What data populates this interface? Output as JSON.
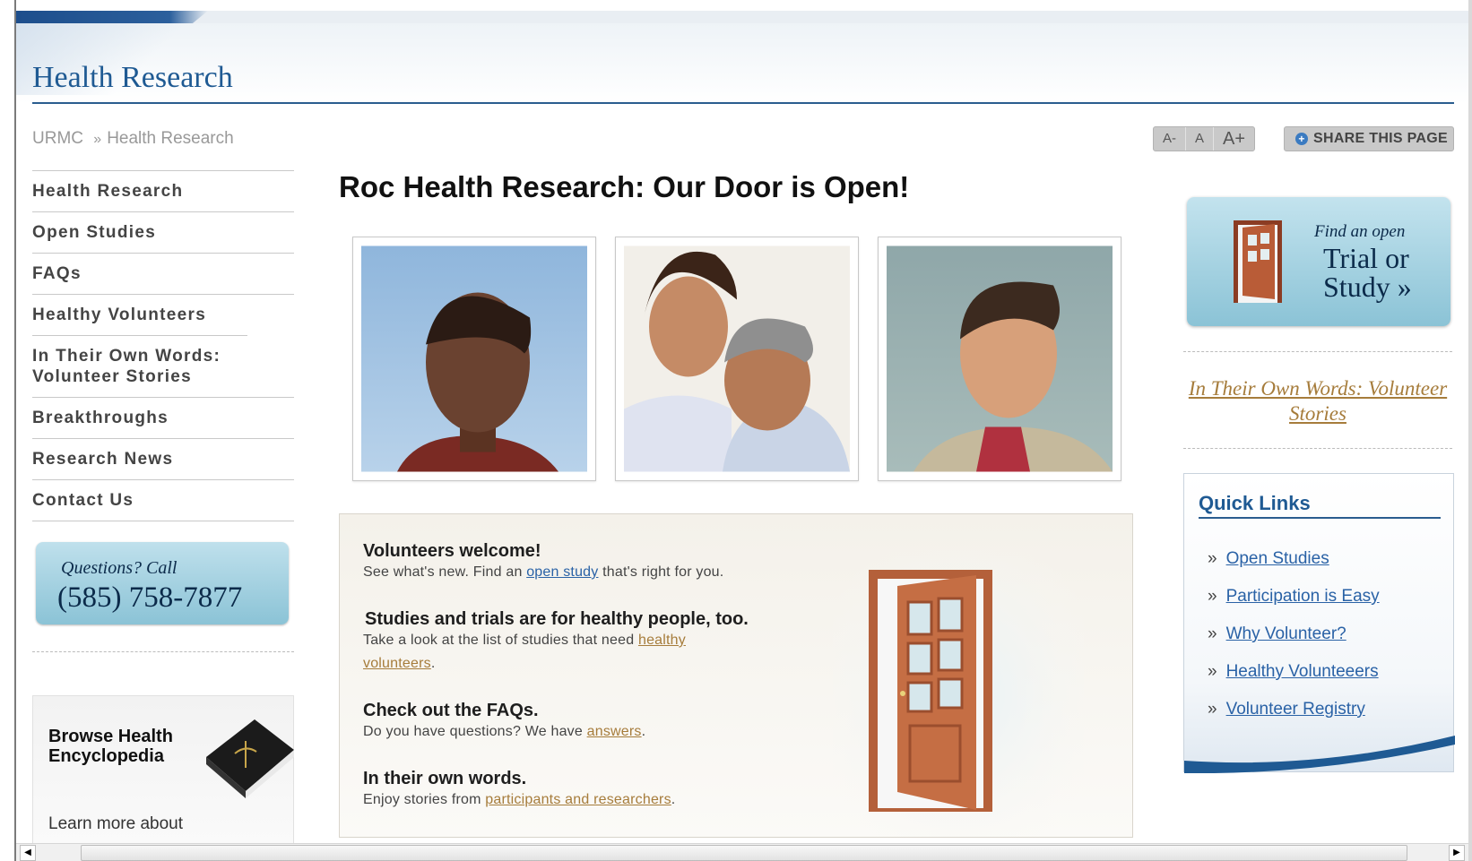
{
  "header": {
    "title": "Health Research"
  },
  "breadcrumb": {
    "root": "URMC",
    "separator": "»",
    "current": "Health Research"
  },
  "toolbar": {
    "font_smaller": "A-",
    "font_normal": "A",
    "font_larger": "A+",
    "share_label": "SHARE THIS PAGE"
  },
  "left_nav": {
    "items": [
      {
        "label": "Health Research"
      },
      {
        "label": "Open Studies"
      },
      {
        "label": "FAQs"
      },
      {
        "label": "Healthy Volunteers"
      },
      {
        "label": "In Their Own Words: Volunteer Stories"
      },
      {
        "label": "Breakthroughs"
      },
      {
        "label": "Research News"
      },
      {
        "label": "Contact Us"
      }
    ]
  },
  "call_box": {
    "question": "Questions? Call",
    "phone": "(585) 758-7877"
  },
  "encyclopedia": {
    "title": "Browse Health Encyclopedia",
    "learn": "Learn more about"
  },
  "main": {
    "title": "Roc Health Research: Our Door is Open!",
    "sections": [
      {
        "heading": "Volunteers welcome!",
        "pre": "See what's new. Find an ",
        "link": "open study",
        "post": " that's right for you."
      },
      {
        "heading": "Studies and trials are for healthy people, too.",
        "pre": "Take a look at the list of studies that need ",
        "link": "healthy volunteers",
        "post": "."
      },
      {
        "heading": "Check out the FAQs.",
        "pre": "Do you have questions? We have ",
        "link": "answers",
        "post": "."
      },
      {
        "heading": "In their own words.",
        "pre": "Enjoy stories from ",
        "link": "participants and researchers",
        "post": "."
      }
    ]
  },
  "trial_box": {
    "find": "Find an open",
    "trial": "Trial or",
    "study": "Study »"
  },
  "stories_link": "In Their Own Words: Volunteer Stories",
  "quick_links": {
    "title": "Quick Links",
    "bullet": "»",
    "items": [
      {
        "label": "Open Studies"
      },
      {
        "label": "Participation is Easy"
      },
      {
        "label": "Why Volunteer?"
      },
      {
        "label": "Healthy Volunteeers"
      },
      {
        "label": "Volunteer Registry"
      }
    ]
  },
  "scrollbar": {
    "left_arrow": "◀",
    "right_arrow": "▶"
  }
}
